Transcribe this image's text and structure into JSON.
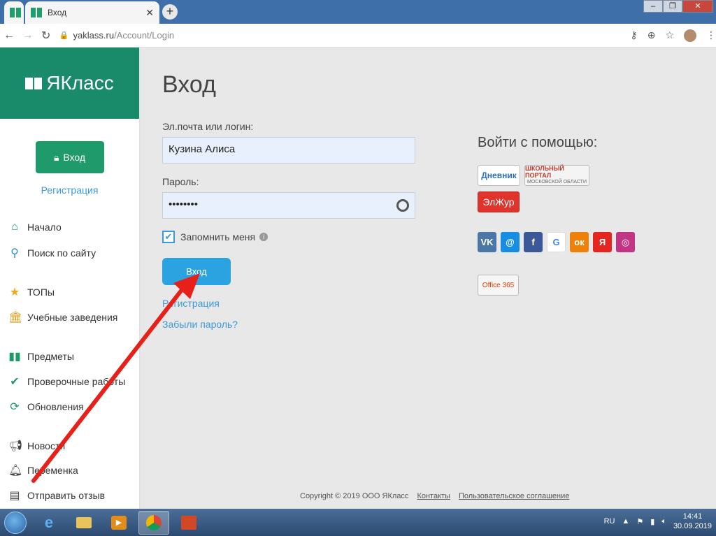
{
  "browser": {
    "tab_title": "Вход",
    "tab_close": "✕",
    "new_tab": "+",
    "url_host": "yaklass.ru",
    "url_path": "/Account/Login",
    "window_controls": [
      "‒",
      "❐",
      "✕"
    ]
  },
  "sidebar": {
    "logo": "ЯКласс",
    "login_button": "Вход",
    "register_link": "Регистрация",
    "menu": [
      {
        "label": "Начало",
        "icon": "home-icon"
      },
      {
        "label": "Поиск по сайту",
        "icon": "search-icon"
      },
      {
        "label": "ТОПы",
        "icon": "star-icon"
      },
      {
        "label": "Учебные заведения",
        "icon": "institution-icon"
      },
      {
        "label": "Предметы",
        "icon": "book-icon"
      },
      {
        "label": "Проверочные работы",
        "icon": "check-circle-icon"
      },
      {
        "label": "Обновления",
        "icon": "refresh-icon"
      },
      {
        "label": "Новости",
        "icon": "megaphone-icon"
      },
      {
        "label": "Переменка",
        "icon": "bell-icon"
      },
      {
        "label": "Отправить отзыв",
        "icon": "feedback-icon"
      }
    ]
  },
  "form": {
    "title": "Вход",
    "login_label": "Эл.почта или логин:",
    "login_value": "Кузина Алиса",
    "password_label": "Пароль:",
    "password_value": "••••••••",
    "remember_label": "Запомнить меня",
    "submit_label": "Вход",
    "register_link": "Регистрация",
    "forgot_link": "Забыли пароль?"
  },
  "social": {
    "title": "Войти с помощью:",
    "dnevnik": "Дневник",
    "school_portal": "ШКОЛЬНЫЙ ПОРТАЛ",
    "school_portal_sub": "МОСКОВСКОЙ ОБЛАСТИ",
    "elzhur": "ЭлЖур",
    "icons": [
      {
        "label": "VK",
        "color": "#4a76a8"
      },
      {
        "label": "@",
        "color": "#168de2"
      },
      {
        "label": "f",
        "color": "#3b5998"
      },
      {
        "label": "G",
        "color": "#ffffff"
      },
      {
        "label": "ок",
        "color": "#ee8208"
      },
      {
        "label": "Я",
        "color": "#e52620"
      },
      {
        "label": "◎",
        "color": "#c13584"
      }
    ],
    "office": "Office 365"
  },
  "footer": {
    "copyright": "Copyright © 2019 ООО ЯКласс",
    "contacts": "Контакты",
    "agreement": "Пользовательское соглашение"
  },
  "taskbar": {
    "lang": "RU",
    "time": "14:41",
    "date": "30.09.2019"
  },
  "colors": {
    "brand_green": "#198a6a",
    "link_blue": "#3a9ad9",
    "button_blue": "#2aa3e0",
    "annotation_red": "#e8201a"
  }
}
